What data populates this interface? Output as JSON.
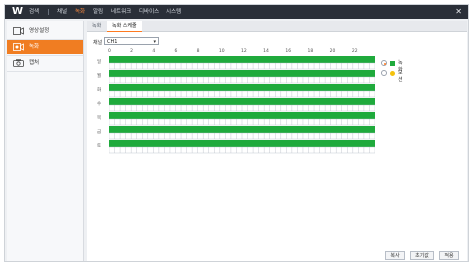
{
  "app": {
    "logo": "W",
    "menu": [
      {
        "label": "검색",
        "active": false
      },
      {
        "label": "채널",
        "active": false
      },
      {
        "label": "녹화",
        "active": true
      },
      {
        "label": "알림",
        "active": false
      },
      {
        "label": "네트워크",
        "active": false
      },
      {
        "label": "디바이스",
        "active": false
      },
      {
        "label": "시스템",
        "active": false
      }
    ],
    "close": "✕"
  },
  "sidebar": {
    "items": [
      {
        "label": "영상설정",
        "icon": "camera-settings-icon",
        "active": false
      },
      {
        "label": "녹화",
        "icon": "record-icon",
        "active": true
      },
      {
        "label": "캡처",
        "icon": "capture-icon",
        "active": false
      }
    ]
  },
  "tabs": [
    {
      "label": "녹화",
      "selected": false
    },
    {
      "label": "녹화 스케줄",
      "selected": true
    }
  ],
  "channel": {
    "label": "채널",
    "value": "CH1"
  },
  "hours": [
    "0",
    "2",
    "4",
    "6",
    "8",
    "10",
    "12",
    "14",
    "16",
    "18",
    "20",
    "22"
  ],
  "days": [
    "일",
    "월",
    "화",
    "수",
    "목",
    "금",
    "토"
  ],
  "schedule": {
    "enabled_all": true
  },
  "legend": [
    {
      "label": "녹화",
      "color": "#1faa3c",
      "selected": true
    },
    {
      "label": "모션",
      "color": "#f4c20d",
      "selected": false
    }
  ],
  "buttons": {
    "copy": "복사",
    "reset": "초기값",
    "apply": "적용"
  },
  "colors": {
    "accent": "#f07d22",
    "record": "#1faa3c",
    "motion": "#f4c20d"
  }
}
